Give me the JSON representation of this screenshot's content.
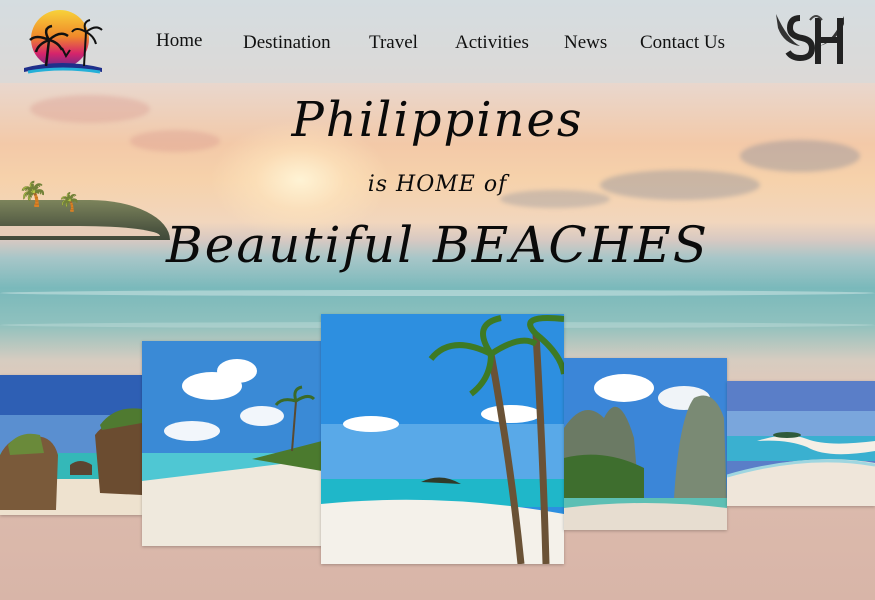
{
  "nav": {
    "items": [
      {
        "label": "Home"
      },
      {
        "label": "Destination"
      },
      {
        "label": "Travel"
      },
      {
        "label": "Activities"
      },
      {
        "label": "News"
      },
      {
        "label": "Contact Us"
      }
    ],
    "logo_icon": "sunset-palm-logo-icon",
    "brand_icon": "sh-monogram-logo-icon"
  },
  "hero": {
    "line1": "Philippines",
    "line2": "is HOME of",
    "line3": "Beautiful BEACHES"
  },
  "gallery": {
    "photos": [
      {
        "name": "rocky-beach-photo"
      },
      {
        "name": "white-sand-beach-photo"
      },
      {
        "name": "palm-beach-photo"
      },
      {
        "name": "limestone-cove-photo"
      },
      {
        "name": "sandbar-photo"
      }
    ]
  },
  "colors": {
    "sea": "#3fb6c8",
    "sand": "#f3efe7",
    "sky": "#2f8fd8"
  }
}
